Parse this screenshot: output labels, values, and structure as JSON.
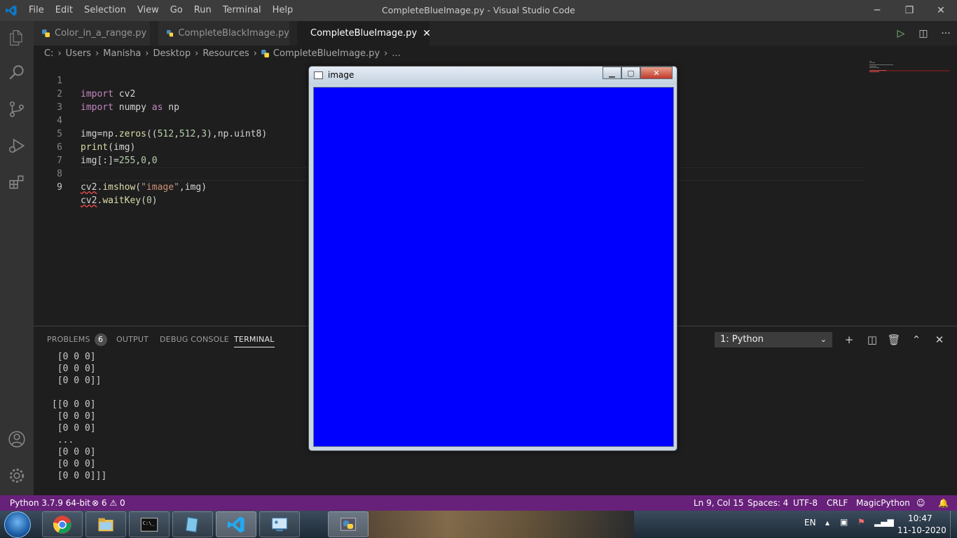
{
  "window": {
    "title": "CompleteBlueImage.py - Visual Studio Code",
    "menu": [
      "File",
      "Edit",
      "Selection",
      "View",
      "Go",
      "Run",
      "Terminal",
      "Help"
    ]
  },
  "tabs": [
    {
      "label": "Color_in_a_range.py",
      "active": false
    },
    {
      "label": "CompleteBlackImage.py",
      "active": false
    },
    {
      "label": "CompleteBlueImage.py",
      "active": true
    }
  ],
  "breadcrumb": [
    "C:",
    "Users",
    "Manisha",
    "Desktop",
    "Resources",
    "CompleteBlueImage.py",
    "..."
  ],
  "editor": {
    "lines": [
      {
        "n": "1",
        "text": "import cv2"
      },
      {
        "n": "2",
        "text": "import numpy as np"
      },
      {
        "n": "3",
        "text": ""
      },
      {
        "n": "4",
        "text": "img=np.zeros((512,512,3),np.uint8)"
      },
      {
        "n": "5",
        "text": "print(img)"
      },
      {
        "n": "6",
        "text": "img[:]=255,0,0"
      },
      {
        "n": "7",
        "text": ""
      },
      {
        "n": "8",
        "text": "cv2.imshow(\"image\",img)"
      },
      {
        "n": "9",
        "text": "cv2.waitKey(0)"
      }
    ]
  },
  "panel": {
    "tabs": {
      "problems": "PROBLEMS",
      "problems_count": "6",
      "output": "OUTPUT",
      "debug": "DEBUG CONSOLE",
      "terminal": "TERMINAL"
    },
    "terminal_select": "1: Python",
    "terminal_lines": [
      " [0 0 0]",
      " [0 0 0]",
      " [0 0 0]]",
      "",
      "[[0 0 0]",
      " [0 0 0]",
      " [0 0 0]",
      " ...",
      " [0 0 0]",
      " [0 0 0]",
      " [0 0 0]]]"
    ]
  },
  "status": {
    "interpreter": "Python 3.7.9 64-bit",
    "errors": "6",
    "warnings": "0",
    "position": "Ln 9, Col 15",
    "spaces": "Spaces: 4",
    "encoding": "UTF-8",
    "eol": "CRLF",
    "language": "MagicPython"
  },
  "cv_window": {
    "title": "image",
    "fill_color": "#0000ff"
  },
  "taskbar": {
    "lang": "EN",
    "time": "10:47",
    "date": "11-10-2020"
  },
  "colors": {
    "status_bar": "#68217a",
    "editor_bg": "#1e1e1e",
    "accent": "#0078d4"
  }
}
